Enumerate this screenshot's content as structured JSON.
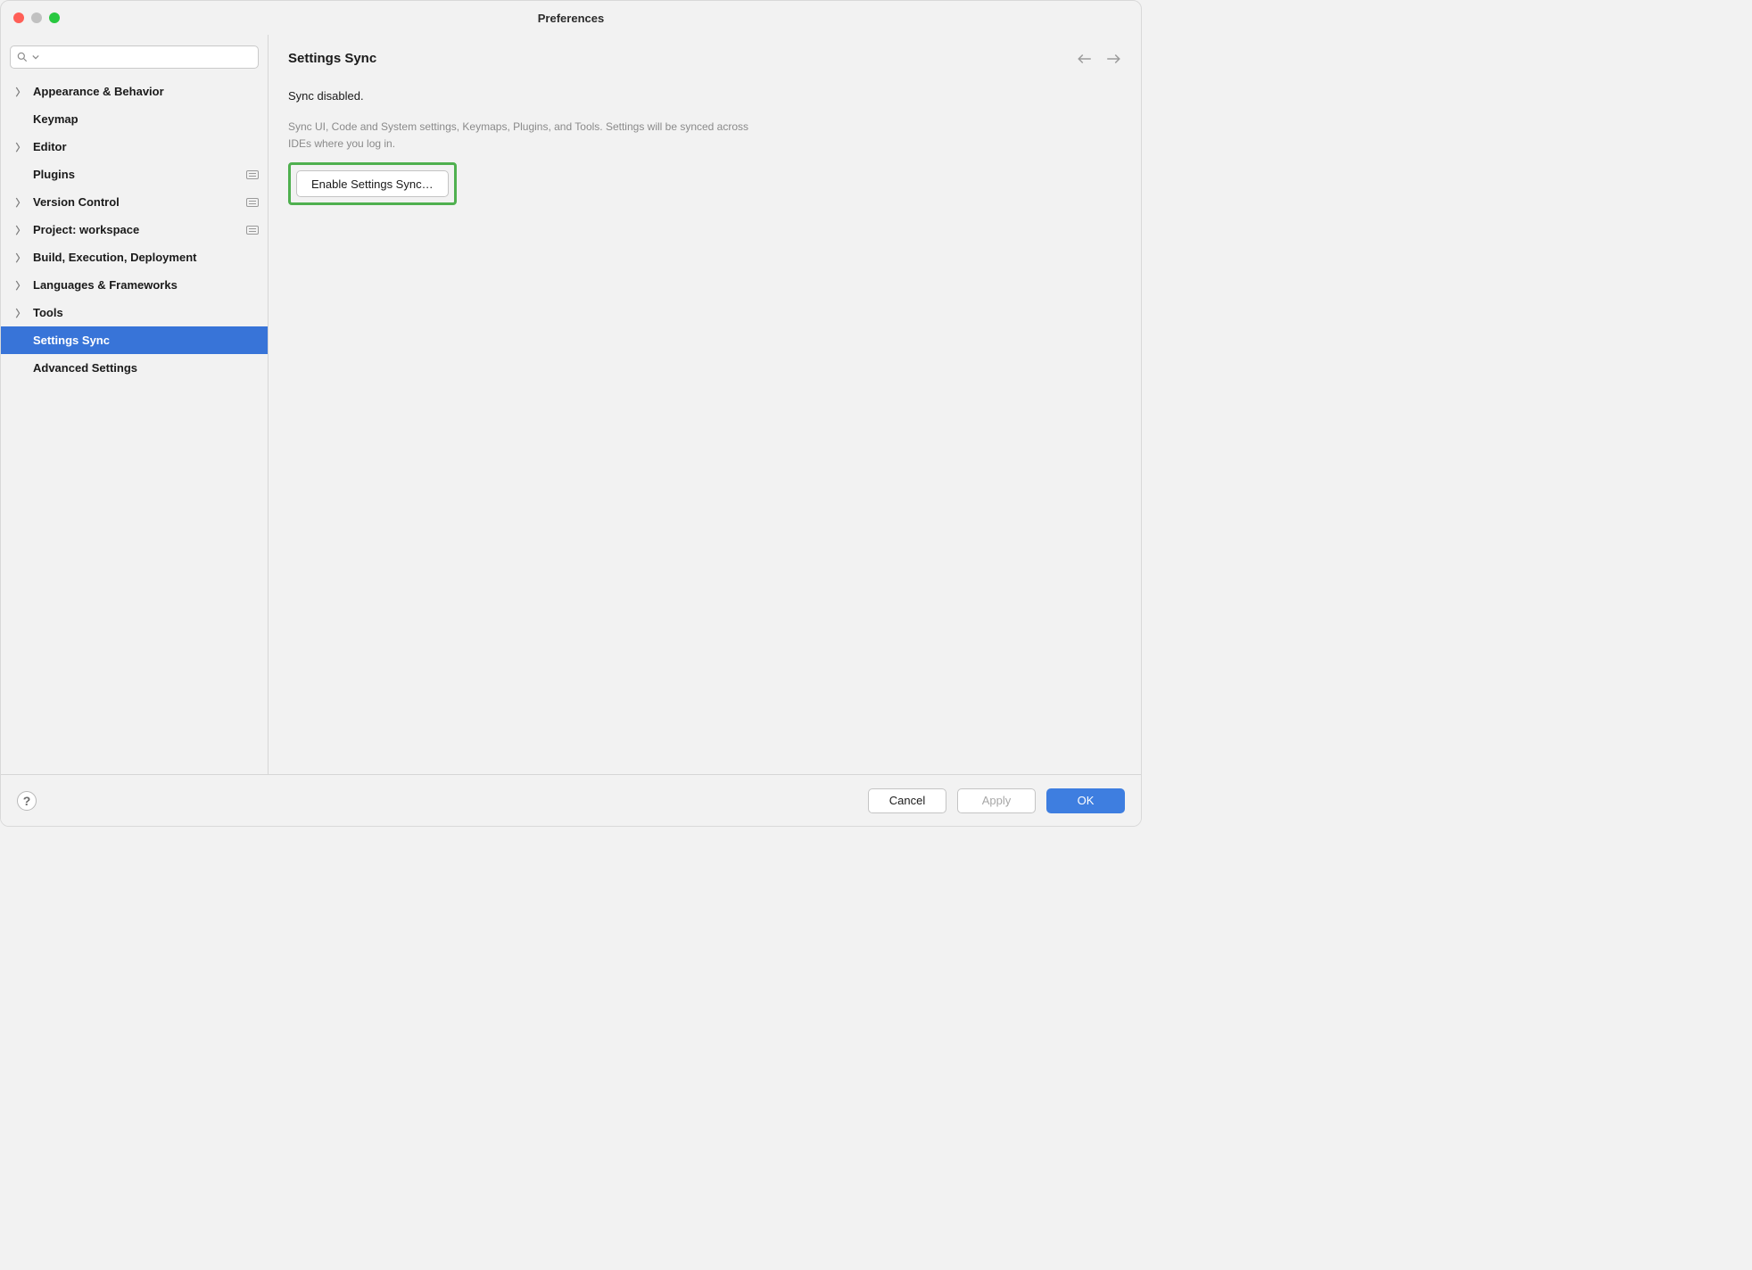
{
  "window": {
    "title": "Preferences"
  },
  "search": {
    "placeholder": ""
  },
  "sidebar": {
    "items": [
      {
        "label": "Appearance & Behavior",
        "expandable": true,
        "badge": false
      },
      {
        "label": "Keymap",
        "expandable": false,
        "badge": false
      },
      {
        "label": "Editor",
        "expandable": true,
        "badge": false
      },
      {
        "label": "Plugins",
        "expandable": false,
        "badge": true
      },
      {
        "label": "Version Control",
        "expandable": true,
        "badge": true
      },
      {
        "label": "Project: workspace",
        "expandable": true,
        "badge": true
      },
      {
        "label": "Build, Execution, Deployment",
        "expandable": true,
        "badge": false
      },
      {
        "label": "Languages & Frameworks",
        "expandable": true,
        "badge": false
      },
      {
        "label": "Tools",
        "expandable": true,
        "badge": false
      },
      {
        "label": "Settings Sync",
        "expandable": false,
        "badge": false,
        "selected": true
      },
      {
        "label": "Advanced Settings",
        "expandable": false,
        "badge": false
      }
    ]
  },
  "main": {
    "title": "Settings Sync",
    "status": "Sync disabled.",
    "description": "Sync UI, Code and System settings, Keymaps, Plugins, and Tools. Settings will be synced across IDEs where you log in.",
    "enable_button": "Enable Settings Sync…"
  },
  "footer": {
    "cancel": "Cancel",
    "apply": "Apply",
    "ok": "OK"
  }
}
